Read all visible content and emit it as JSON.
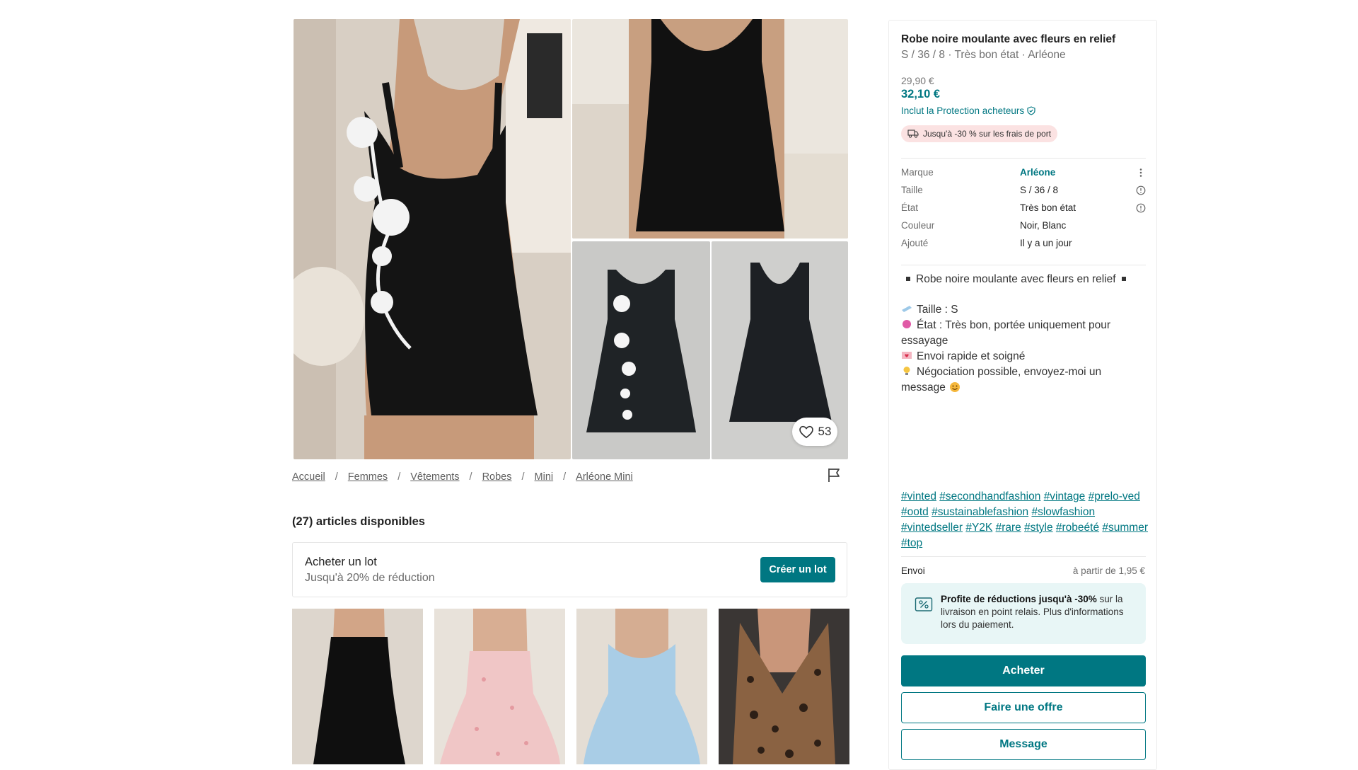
{
  "gallery": {
    "likes": "53"
  },
  "breadcrumb": [
    "Accueil",
    "Femmes",
    "Vêtements",
    "Robes",
    "Mini",
    "Arléone Mini"
  ],
  "items_available": "(27) articles disponibles",
  "bundle": {
    "title": "Acheter un lot",
    "subtitle": "Jusqu'à 20% de réduction",
    "button": "Créer un lot"
  },
  "product": {
    "title": "Robe noire moulante avec fleurs en relief",
    "subtitle": "S / 36 / 8 · Très bon état · Arléone",
    "old_price": "29,90 €",
    "price": "32,10 €",
    "protection": "Inclut la Protection acheteurs",
    "promo": "Jusqu'à -30 % sur les frais de port",
    "details": [
      {
        "label": "Marque",
        "value": "Arléone"
      },
      {
        "label": "Taille",
        "value": "S / 36 / 8"
      },
      {
        "label": "État",
        "value": "Très bon état"
      },
      {
        "label": "Couleur",
        "value": "Noir, Blanc"
      },
      {
        "label": "Ajouté",
        "value": "Il y a un jour"
      }
    ],
    "description": {
      "headline": "Robe noire moulante avec fleurs en relief",
      "size": "Taille : S",
      "condition": "État : Très bon, portée uniquement pour essayage",
      "shipping": "Envoi rapide et soigné",
      "negotiation": "Négociation possible, envoyez-moi un message"
    },
    "tags": [
      "#vinted",
      "#secondhandfashion",
      "#vintage",
      "#prelo-ved",
      "#ootd",
      "#sustainablefashion",
      "#slowfashion",
      "#vintedseller",
      "#Y2K",
      "#rare",
      "#style",
      "#robeété",
      "#summer",
      "#top"
    ],
    "shipping": {
      "label": "Envoi",
      "value": "à partir de 1,95 €"
    },
    "info_bold": "Profite de réductions jusqu'à -30%",
    "info_rest": "sur la livraison en point relais. Plus d'informations lors du paiement.",
    "buttons": {
      "buy": "Acheter",
      "offer": "Faire une offre",
      "message": "Message"
    }
  },
  "colors": {
    "accent": "#007782",
    "promo_bg": "#fbe2e2",
    "info_bg": "#e8f6f6"
  }
}
